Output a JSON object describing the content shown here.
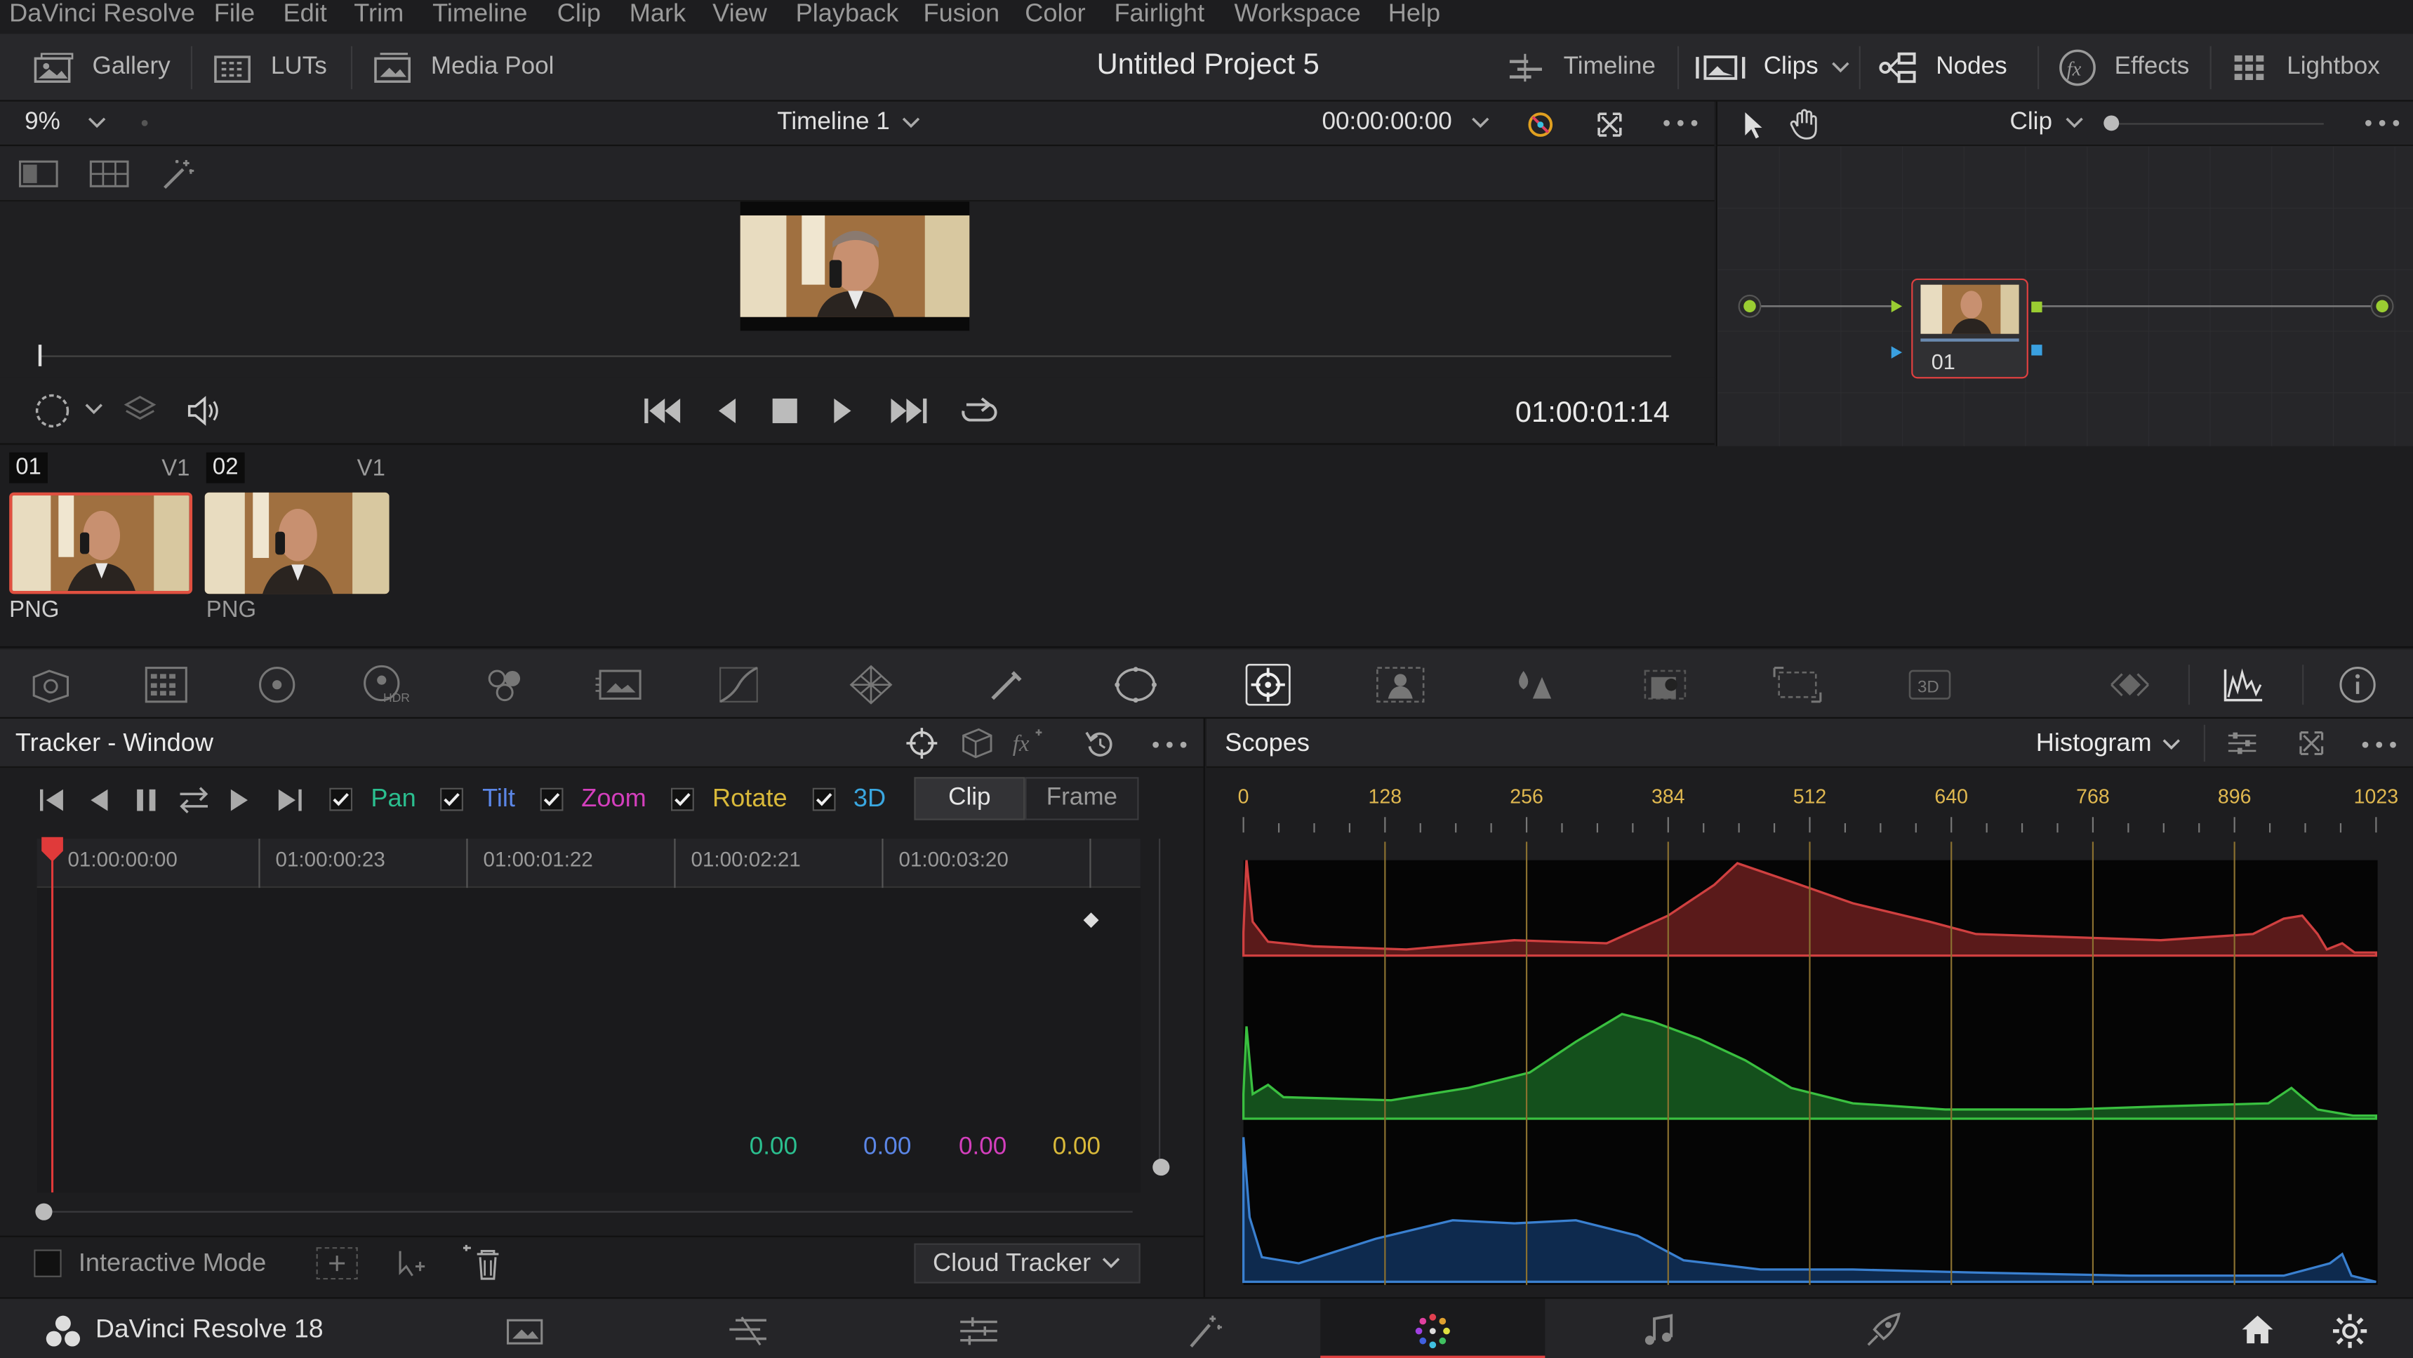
{
  "menubar": {
    "app": "DaVinci Resolve",
    "items": [
      "File",
      "Edit",
      "Trim",
      "Timeline",
      "Clip",
      "Mark",
      "View",
      "Playback",
      "Fusion",
      "Color",
      "Fairlight",
      "Workspace",
      "Help"
    ]
  },
  "toolbar": {
    "gallery": "Gallery",
    "luts": "LUTs",
    "media_pool": "Media Pool",
    "project_title": "Untitled Project 5",
    "timeline": "Timeline",
    "clips": "Clips",
    "nodes": "Nodes",
    "effects": "Effects",
    "lightbox": "Lightbox"
  },
  "viewer": {
    "zoom": "9%",
    "timeline_name": "Timeline 1",
    "timecode_top": "00:00:00:00",
    "timecode_current": "01:00:01:14",
    "clip_mode": "Clip"
  },
  "nodes": {
    "node_label": "01"
  },
  "clips": [
    {
      "number": "01",
      "track": "V1",
      "format": "PNG",
      "selected": true
    },
    {
      "number": "02",
      "track": "V1",
      "format": "PNG",
      "selected": false
    }
  ],
  "tracker": {
    "title": "Tracker - Window",
    "pan": "Pan",
    "tilt": "Tilt",
    "zoom": "Zoom",
    "rotate": "Rotate",
    "three_d": "3D",
    "clip_btn": "Clip",
    "frame_btn": "Frame",
    "timecodes": [
      "01:00:00:00",
      "01:00:00:23",
      "01:00:01:22",
      "01:00:02:21",
      "01:00:03:20"
    ],
    "values": {
      "pan": "0.00",
      "tilt": "0.00",
      "zoom": "0.00",
      "rotate": "0.00"
    },
    "interactive_mode": "Interactive Mode",
    "cloud_tracker": "Cloud Tracker",
    "colors": {
      "pan": "#2bbf8f",
      "tilt": "#5b86e6",
      "zoom": "#d43fbd",
      "rotate": "#d9b93a",
      "three_d": "#3aa7e0"
    }
  },
  "scopes": {
    "title": "Scopes",
    "mode": "Histogram",
    "scale": [
      "0",
      "128",
      "256",
      "384",
      "512",
      "640",
      "768",
      "896",
      "1023"
    ]
  },
  "footer": {
    "app_version": "DaVinci Resolve 18"
  }
}
